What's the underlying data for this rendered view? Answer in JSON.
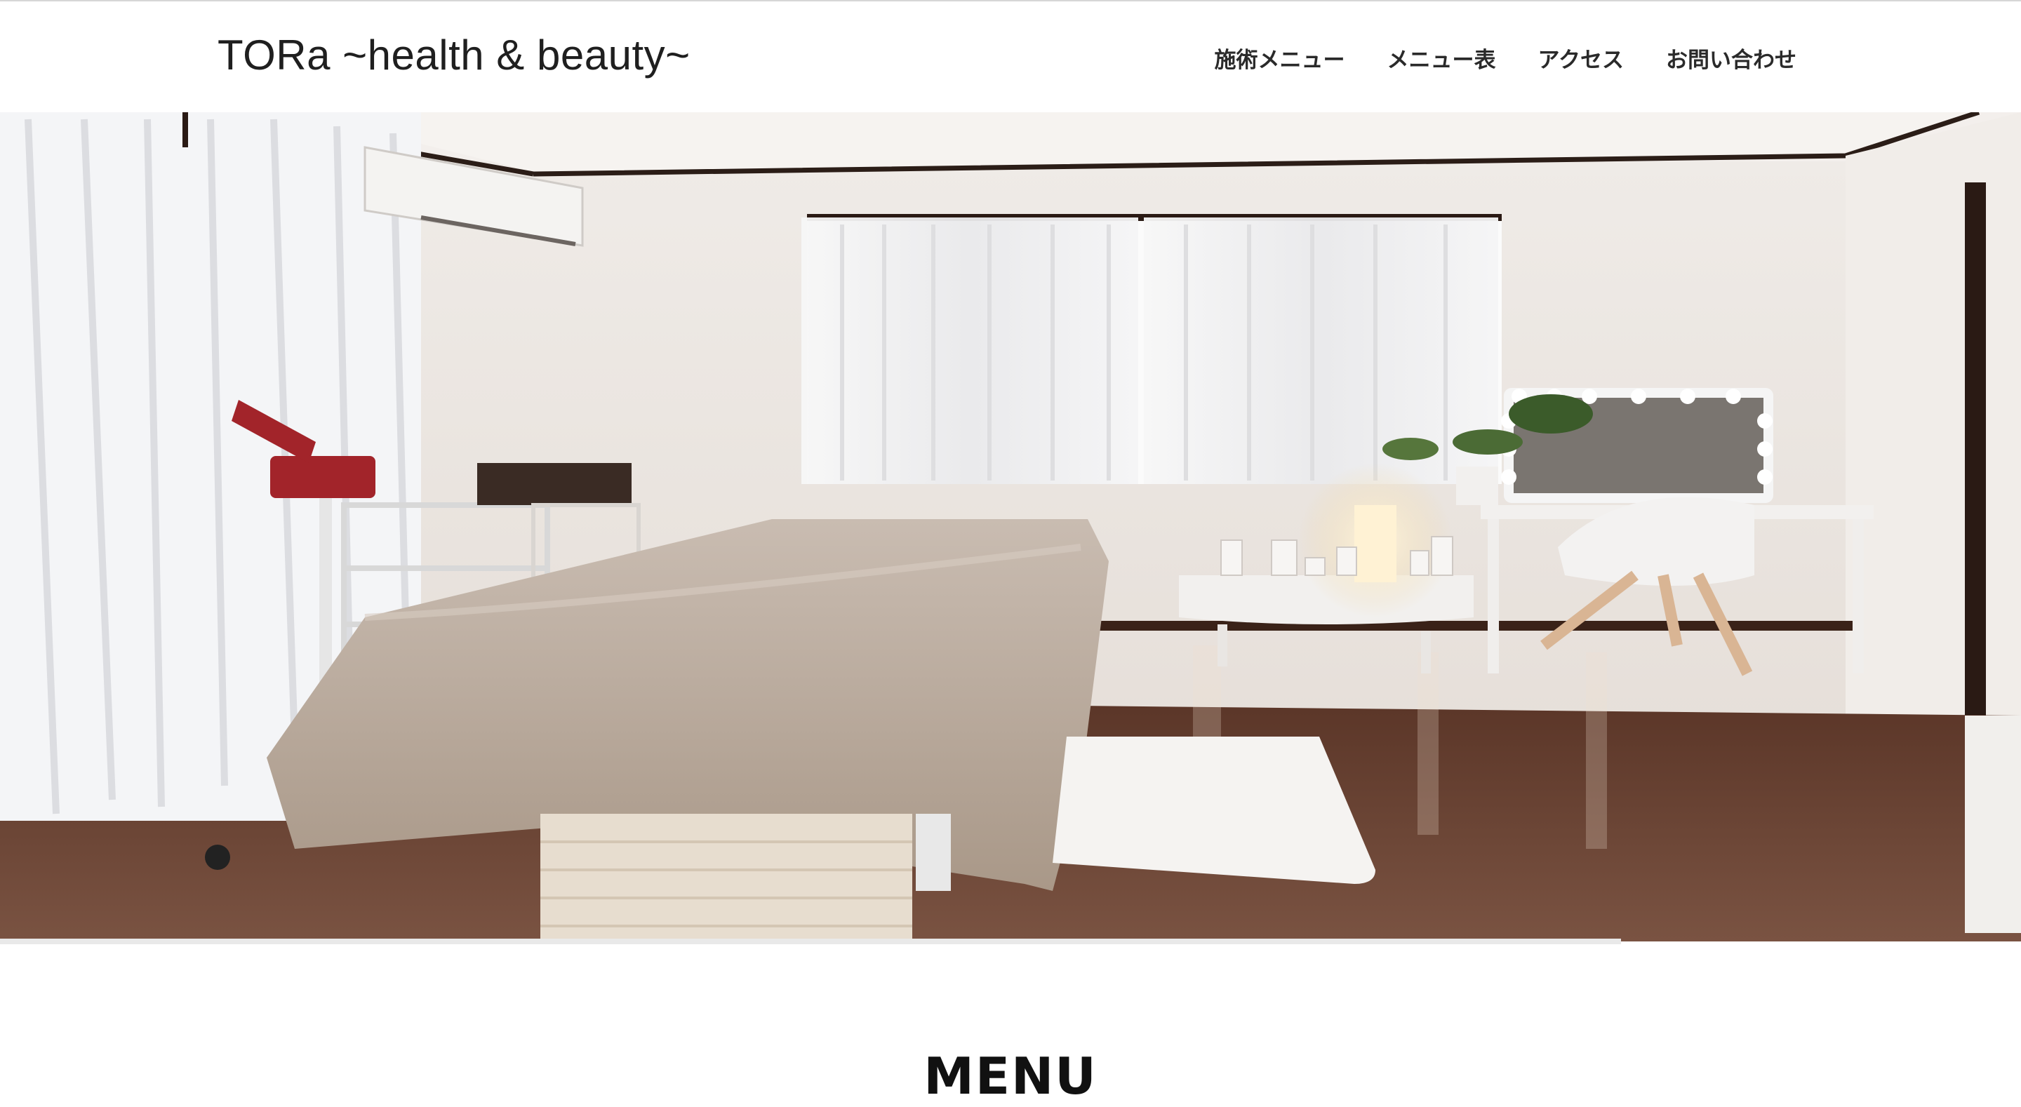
{
  "header": {
    "site_title": "TORa ~health & beauty~",
    "nav": [
      {
        "label": "施術メニュー"
      },
      {
        "label": "メニュー表"
      },
      {
        "label": "アクセス"
      },
      {
        "label": "お問い合わせ"
      }
    ]
  },
  "hero": {
    "alt": "treatment-room-photo"
  },
  "main": {
    "section_title": "MENU"
  },
  "colors": {
    "header_bg": "#ffffff",
    "text": "#222222",
    "floor": "#6b4434",
    "wall": "#ece7e2"
  }
}
